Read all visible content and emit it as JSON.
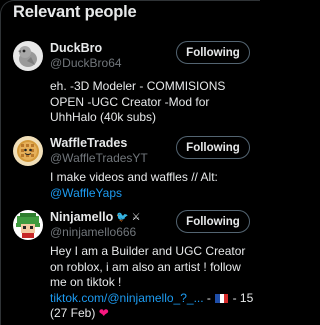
{
  "section": {
    "title": "Relevant people"
  },
  "people": [
    {
      "display_name": "DuckBro",
      "handle": "@DuckBro64",
      "follow_label": "Following",
      "bio": "eh. -3D Modeler - COMMISIONS OPEN -UGC Creator -Mod for UhhHalo (40k subs)",
      "avatar_icon": "gray-bird-avatar"
    },
    {
      "display_name": "WaffleTrades",
      "handle": "@WaffleTradesYT",
      "follow_label": "Following",
      "bio_text": "I make videos and waffles // Alt: ",
      "bio_link": "@WaffleYaps",
      "avatar_icon": "waffle-avatar"
    },
    {
      "display_name": "Ninjamello",
      "badge_icons": [
        "bird-emoji",
        "crossed-swords-emoji"
      ],
      "badges_text": "🐦 ⚔",
      "handle": "@ninjamello666",
      "follow_label": "Following",
      "bio_text": "Hey I am a Builder and UGC Creator on roblox, i am also an artist ! follow me on tiktok ! ",
      "bio_link": "tiktok.com/@ninjamello_?_...",
      "bio_dash": " - ",
      "flag_icon": "france-flag",
      "bio_suffix": " - 15 (27 Feb) ",
      "heart": "❤",
      "avatar_icon": "pixel-art-avatar"
    }
  ],
  "colors": {
    "background": "#000000",
    "text_primary": "#e7e9ea",
    "text_secondary": "#71767b",
    "link": "#1d9bf0",
    "heart": "#f91880",
    "button_border": "#536471"
  }
}
